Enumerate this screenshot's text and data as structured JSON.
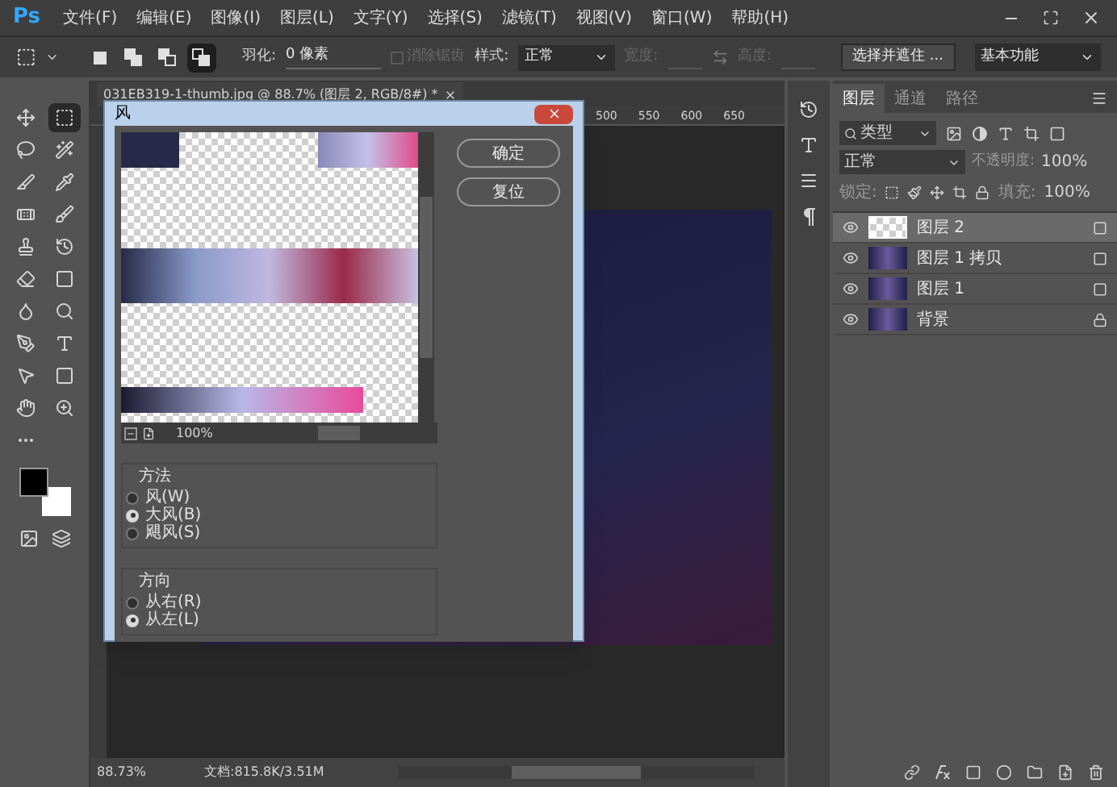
{
  "app": {
    "logo": "Ps"
  },
  "menu": [
    "文件(F)",
    "编辑(E)",
    "图像(I)",
    "图层(L)",
    "文字(Y)",
    "选择(S)",
    "滤镜(T)",
    "视图(V)",
    "窗口(W)",
    "帮助(H)"
  ],
  "options": {
    "selection_modes": [
      {
        "kind": "new",
        "selected": false
      },
      {
        "kind": "add",
        "selected": false
      },
      {
        "kind": "subtract",
        "selected": false
      },
      {
        "kind": "intersect",
        "selected": true
      }
    ],
    "feather_label": "羽化:",
    "feather_value": "0 像素",
    "antialias": {
      "label": "消除锯齿",
      "disabled": true
    },
    "style_label": "样式:",
    "style_value": "正常",
    "width_label": "宽度:",
    "height_label": "高度:",
    "mask_button": "选择并遮住 ...",
    "workspace": "基本功能"
  },
  "tools": [
    {
      "kind": "move",
      "selected": false
    },
    {
      "kind": "marquee",
      "selected": true
    },
    {
      "kind": "lasso",
      "selected": false
    },
    {
      "kind": "wand",
      "selected": false
    },
    {
      "kind": "slice",
      "selected": false
    },
    {
      "kind": "eyedropper",
      "selected": false
    },
    {
      "kind": "healing",
      "selected": false
    },
    {
      "kind": "brush",
      "selected": false
    },
    {
      "kind": "stamp",
      "selected": false
    },
    {
      "kind": "history",
      "selected": false
    },
    {
      "kind": "eraser",
      "selected": false
    },
    {
      "kind": "gradient",
      "selected": false
    },
    {
      "kind": "blur",
      "selected": false
    },
    {
      "kind": "dodge",
      "selected": false
    },
    {
      "kind": "pen",
      "selected": false
    },
    {
      "kind": "type",
      "selected": false
    },
    {
      "kind": "path",
      "selected": false
    },
    {
      "kind": "shape",
      "selected": false
    },
    {
      "kind": "hand",
      "selected": false
    },
    {
      "kind": "zoom",
      "selected": false
    },
    {
      "kind": "more",
      "selected": false
    }
  ],
  "document": {
    "tab": "031EB319-1-thumb.jpg @ 88.7% (图层 2, RGB/8#) *",
    "ruler_marks": [
      "500",
      "550",
      "600",
      "650"
    ]
  },
  "dialog": {
    "title": "风",
    "buttons": [
      "确定",
      "复位"
    ],
    "zoom": "100%",
    "groups": [
      {
        "title": "方法",
        "options": [
          {
            "label": "风(W)",
            "selected": false
          },
          {
            "label": "大风(B)",
            "selected": true
          },
          {
            "label": "飓风(S)",
            "selected": false
          }
        ]
      },
      {
        "title": "方向",
        "options": [
          {
            "label": "从右(R)",
            "selected": false
          },
          {
            "label": "从左(L)",
            "selected": true
          }
        ]
      }
    ]
  },
  "layers_panel": {
    "tabs": [
      {
        "label": "图层",
        "selected": true
      },
      {
        "label": "通道",
        "selected": false
      },
      {
        "label": "路径",
        "selected": false
      }
    ],
    "filter": "类型",
    "blend_mode": "正常",
    "opacity_label": "不透明度:",
    "opacity": "100%",
    "lock_label": "锁定:",
    "fill_label": "填充:",
    "fill": "100%",
    "layers": [
      {
        "name": "图层 2",
        "selected": true,
        "kind": "transparent",
        "locked": false
      },
      {
        "name": "图层 1 拷贝",
        "selected": false,
        "kind": "photo",
        "locked": false
      },
      {
        "name": "图层 1",
        "selected": false,
        "kind": "photo",
        "locked": false
      },
      {
        "name": "背景",
        "selected": false,
        "kind": "photo",
        "locked": true
      }
    ]
  },
  "status_bar": {
    "zoom": "88.73%",
    "doc": "文档:815.8K/3.51M"
  }
}
